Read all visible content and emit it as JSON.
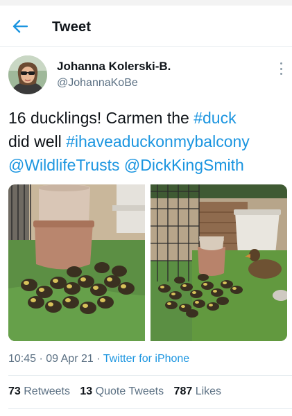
{
  "header": {
    "title": "Tweet",
    "back_icon": "arrow-left-icon"
  },
  "tweet": {
    "author": {
      "name": "Johanna Kolerski-B.",
      "handle": "@JohannaKoBe"
    },
    "text": {
      "line1_plain": "16 ducklings! Carmen the ",
      "line1_link": "#duck",
      "line2_plain": "did well ",
      "line2_link": "#ihaveaduckonmybalcony",
      "line3_link1": "@WildlifeTrusts",
      "line3_link2": "@DickKingSmith"
    },
    "meta": {
      "time": "10:45",
      "sep": " · ",
      "date": "09 Apr 21",
      "source": "Twitter for iPhone"
    },
    "stats": {
      "retweets_count": "73",
      "retweets_label": "Retweets",
      "quotes_count": "13",
      "quotes_label": "Quote Tweets",
      "likes_count": "787",
      "likes_label": "Likes"
    }
  },
  "colors": {
    "link": "#1b95e0",
    "secondary_text": "#5b7083",
    "primary_text": "#0f1419",
    "divider": "#e6ecf0"
  }
}
